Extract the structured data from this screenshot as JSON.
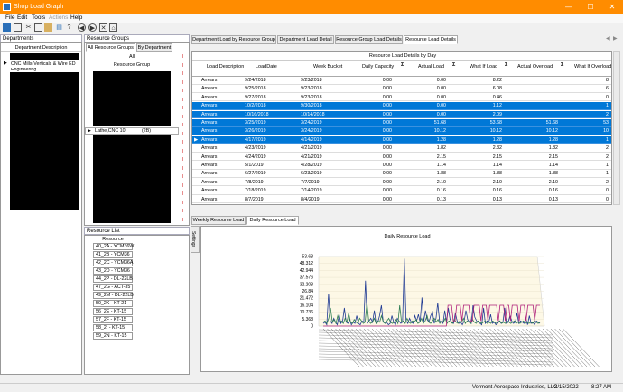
{
  "window": {
    "title": "Shop Load Graph",
    "minimize": "—",
    "maximize": "☐",
    "close": "✕"
  },
  "menu": [
    "File",
    "Edit",
    "Tools",
    "Actions",
    "Help"
  ],
  "departments": {
    "header": "Departments",
    "col": "Department Description",
    "selected": "CNC Mills-Verticals & Wire ED",
    "next": "Engineering"
  },
  "resource_groups": {
    "header": "Resource Groups",
    "tabs": [
      "All Resource Groups",
      "By Department"
    ],
    "all_label": "All",
    "col": "Resource Group",
    "selected": "Lathe,CNC 10'",
    "count": "(2B)"
  },
  "main_tabs": [
    "Department Load by Resource Group",
    "Department Load Detail",
    "Resource Group Load Details",
    "Resource Load Details"
  ],
  "grid": {
    "title": "Resource Load Details by Day",
    "columns": [
      "Load Description",
      "LoadDate",
      "Week Bucket",
      "Daily Capacity",
      "Actual Load",
      "What If Load",
      "Actual Overload",
      "What If Overload"
    ],
    "rows": [
      {
        "d": "Arrears",
        "ld": "9/24/2018",
        "wb": "9/23/2018",
        "cap": "0.00",
        "al": "0.00",
        "wl": "8.22",
        "ao": "",
        "wo": "8"
      },
      {
        "d": "Arrears",
        "ld": "9/25/2018",
        "wb": "9/23/2018",
        "cap": "0.00",
        "al": "0.00",
        "wl": "6.08",
        "ao": "",
        "wo": "6"
      },
      {
        "d": "Arrears",
        "ld": "9/27/2018",
        "wb": "9/23/2018",
        "cap": "0.00",
        "al": "0.00",
        "wl": "0.46",
        "ao": "",
        "wo": "0"
      },
      {
        "d": "Arrears",
        "ld": "10/2/2018",
        "wb": "9/30/2018",
        "cap": "0.00",
        "al": "0.00",
        "wl": "1.12",
        "ao": "",
        "wo": "1"
      },
      {
        "d": "Arrears",
        "ld": "10/16/2018",
        "wb": "10/14/2018",
        "cap": "0.00",
        "al": "0.00",
        "wl": "2.09",
        "ao": "",
        "wo": "2"
      },
      {
        "d": "Arrears",
        "ld": "3/25/2019",
        "wb": "3/24/2019",
        "cap": "0.00",
        "al": "51.68",
        "wl": "53.68",
        "ao": "51.68",
        "wo": "53"
      },
      {
        "d": "Arrears",
        "ld": "3/26/2019",
        "wb": "3/24/2019",
        "cap": "0.00",
        "al": "10.12",
        "wl": "10.12",
        "ao": "10.12",
        "wo": "10"
      },
      {
        "d": "Arrears",
        "ld": "4/17/2019",
        "wb": "4/14/2019",
        "cap": "0.00",
        "al": "1.28",
        "wl": "1.28",
        "ao": "1.28",
        "wo": "1"
      },
      {
        "d": "Arrears",
        "ld": "4/23/2019",
        "wb": "4/21/2019",
        "cap": "0.00",
        "al": "1.82",
        "wl": "2.32",
        "ao": "1.82",
        "wo": "2"
      },
      {
        "d": "Arrears",
        "ld": "4/24/2019",
        "wb": "4/21/2019",
        "cap": "0.00",
        "al": "2.15",
        "wl": "2.15",
        "ao": "2.15",
        "wo": "2"
      },
      {
        "d": "Arrears",
        "ld": "5/1/2019",
        "wb": "4/28/2019",
        "cap": "0.00",
        "al": "1.14",
        "wl": "1.14",
        "ao": "1.14",
        "wo": "1"
      },
      {
        "d": "Arrears",
        "ld": "6/27/2019",
        "wb": "6/23/2019",
        "cap": "0.00",
        "al": "1.88",
        "wl": "1.88",
        "ao": "1.88",
        "wo": "1"
      },
      {
        "d": "Arrears",
        "ld": "7/8/2019",
        "wb": "7/7/2019",
        "cap": "0.00",
        "al": "2.10",
        "wl": "2.10",
        "ao": "2.10",
        "wo": "2"
      },
      {
        "d": "Arrears",
        "ld": "7/18/2019",
        "wb": "7/14/2019",
        "cap": "0.00",
        "al": "0.16",
        "wl": "0.16",
        "ao": "0.16",
        "wo": "0"
      },
      {
        "d": "Arrears",
        "ld": "8/7/2019",
        "wb": "8/4/2019",
        "cap": "0.00",
        "al": "0.13",
        "wl": "0.13",
        "ao": "0.13",
        "wo": "0"
      }
    ]
  },
  "load_tabs": [
    "Weekly Resource Load",
    "Daily Resource Load"
  ],
  "settings_label": "Settings",
  "resource_list": {
    "header": "Resource List",
    "col": "Resource",
    "items": [
      "40_2A - YCM36W",
      "41_2B - YCM36",
      "42_2C - YCM36A",
      "43_2D - YCM36",
      "44_2P - DL-22LB",
      "47_2G - ACT-35",
      "49_2M - DL-22LB",
      "50_2K - KT-21",
      "56_2E - KT-15",
      "57_2F - KT-15",
      "58_2I - KT-15",
      "59_2N - KT-15"
    ]
  },
  "chart_data": {
    "type": "line",
    "title": "Daily Resource Load",
    "yticks": [
      "53.68",
      "48.312",
      "42.944",
      "37.576",
      "32.208",
      "26.84",
      "21.472",
      "16.104",
      "10.736",
      "5.368",
      "0"
    ],
    "ylim": [
      0,
      53.68
    ],
    "series": [
      {
        "color": "#1f3a93",
        "values": [
          2,
          3,
          1,
          25,
          4,
          2,
          6,
          3,
          1,
          9,
          2,
          4,
          14,
          3,
          2,
          5,
          1,
          3,
          2,
          8,
          2,
          1,
          4,
          3,
          35,
          2,
          4,
          6,
          3,
          12,
          2,
          3,
          8,
          16,
          4,
          2,
          3,
          1,
          2,
          8,
          3,
          1,
          6,
          4,
          2,
          3,
          52,
          4,
          2,
          6,
          3,
          2,
          8,
          4,
          9,
          3,
          22,
          3,
          12,
          5,
          3,
          8,
          11,
          2,
          6,
          18,
          4,
          3,
          2,
          12,
          3,
          14,
          5,
          3,
          2,
          10,
          4,
          2,
          3,
          1,
          4,
          12,
          5,
          3,
          2,
          16,
          7,
          4,
          3,
          2,
          1,
          14,
          2,
          4,
          3,
          9,
          2,
          3,
          1,
          2,
          4,
          2,
          3,
          14,
          2,
          3,
          8,
          4,
          2,
          3,
          10,
          2,
          4,
          3,
          2,
          6,
          1,
          8,
          2,
          3,
          1,
          4,
          3,
          2
        ]
      },
      {
        "color": "#2e7d52",
        "values": [
          3,
          4,
          2,
          6,
          14,
          3,
          5,
          2,
          8,
          3,
          4,
          2,
          6,
          3,
          10,
          3,
          2,
          5,
          3,
          2,
          6,
          4,
          2,
          3,
          18,
          4,
          2,
          3,
          6,
          2,
          4,
          3,
          8,
          3,
          2,
          4,
          6,
          3,
          2,
          3,
          5,
          2,
          16,
          3,
          4,
          2,
          6,
          3,
          2,
          4,
          3,
          5,
          2,
          3,
          6,
          2,
          4,
          8,
          3,
          2,
          4,
          6,
          3,
          5,
          2,
          4,
          3,
          6,
          2,
          4,
          3,
          2,
          5,
          3,
          2,
          4,
          3,
          6,
          2,
          4,
          3,
          2,
          5,
          3,
          2,
          4,
          3,
          2,
          3,
          4,
          2,
          3,
          2,
          4,
          3,
          2,
          3,
          4,
          2,
          3,
          2,
          4,
          3,
          2,
          3,
          4,
          2,
          3,
          2,
          3,
          4,
          2,
          3,
          2,
          3,
          2,
          4,
          3,
          2,
          3
        ]
      },
      {
        "color": "#b0207a",
        "values": [
          0,
          0,
          0,
          0,
          0,
          0,
          0,
          0,
          0,
          0,
          0,
          0,
          0,
          0,
          0,
          0,
          0,
          0,
          0,
          0,
          0,
          0,
          0,
          0,
          0,
          0,
          0,
          0,
          0,
          0,
          0,
          0,
          0,
          0,
          0,
          0,
          0,
          0,
          0,
          0,
          0,
          0,
          0,
          0,
          0,
          0,
          0,
          0,
          0,
          0,
          0,
          0,
          0,
          0,
          0,
          0,
          0,
          0,
          0,
          0,
          0,
          0,
          0,
          0,
          0,
          0,
          0,
          0,
          0,
          0,
          0,
          0,
          16,
          16,
          16,
          4,
          4,
          16,
          16,
          16,
          4,
          16,
          16,
          16,
          16,
          4,
          4,
          16,
          16,
          16,
          16,
          4,
          16,
          16,
          16,
          4,
          16,
          16,
          16,
          16,
          16,
          4,
          16,
          16,
          16,
          4,
          16,
          16,
          4,
          16,
          16,
          16,
          16,
          4,
          16,
          16,
          16,
          4,
          16,
          16,
          16,
          16,
          4,
          16,
          16,
          16
        ]
      }
    ]
  },
  "status": {
    "company": "Vermont Aerospace Industries, LLC",
    "date": "3/15/2022",
    "time": "8:27 AM"
  }
}
